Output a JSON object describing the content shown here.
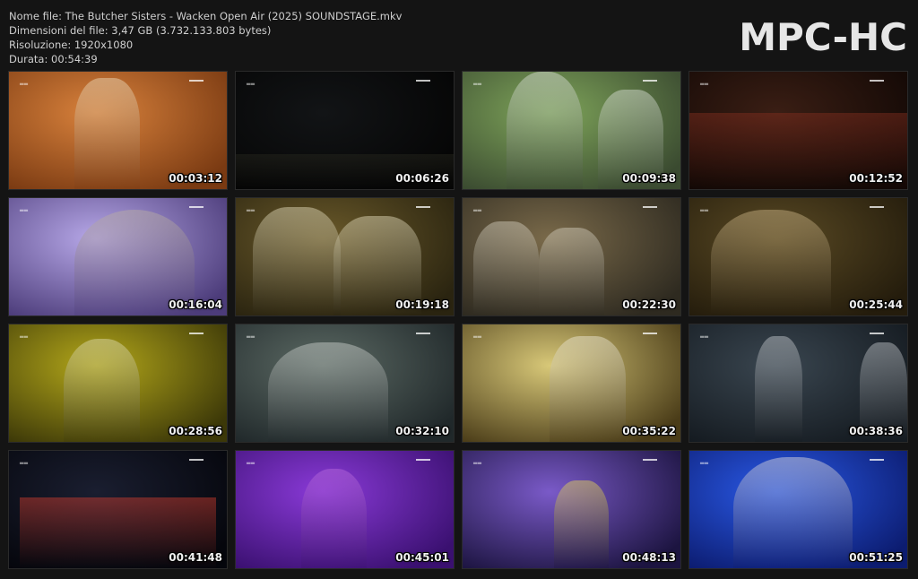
{
  "header": {
    "file_name": "Nome file: The Butcher Sisters - Wacken Open Air (2025) SOUNDSTAGE.mkv",
    "file_size": "Dimensioni del file: 3,47 GB (3.732.133.803 bytes)",
    "resolution": "Risoluzione: 1920x1080",
    "duration": "Durata: 00:54:39",
    "logo": "MPC-HC"
  },
  "thumbnails": [
    {
      "timestamp": "00:03:12",
      "bg": [
        "#d9823c",
        "#7a3a12"
      ],
      "accent": "#f2e6c8"
    },
    {
      "timestamp": "00:06:26",
      "bg": [
        "#121416",
        "#050505"
      ],
      "accent": "#2a2a20"
    },
    {
      "timestamp": "00:09:38",
      "bg": [
        "#7fa55a",
        "#3a4a30"
      ],
      "accent": "#e8ece6"
    },
    {
      "timestamp": "00:12:52",
      "bg": [
        "#3a1e14",
        "#120805"
      ],
      "accent": "#8a3020"
    },
    {
      "timestamp": "00:16:04",
      "bg": [
        "#b7a8e8",
        "#4c3c7a"
      ],
      "accent": "#bfb4a0"
    },
    {
      "timestamp": "00:19:18",
      "bg": [
        "#6b5a2a",
        "#2a2410"
      ],
      "accent": "#efe8c8"
    },
    {
      "timestamp": "00:22:30",
      "bg": [
        "#7a6a4a",
        "#2e2a20"
      ],
      "accent": "#ddd8c8"
    },
    {
      "timestamp": "00:25:44",
      "bg": [
        "#5a4a24",
        "#241c0c"
      ],
      "accent": "#d8c090"
    },
    {
      "timestamp": "00:28:56",
      "bg": [
        "#b4a81a",
        "#3c3808"
      ],
      "accent": "#e8e6c0"
    },
    {
      "timestamp": "00:32:10",
      "bg": [
        "#5c6a64",
        "#20282a"
      ],
      "accent": "#d8dcd8"
    },
    {
      "timestamp": "00:35:22",
      "bg": [
        "#d8c878",
        "#4a3c18"
      ],
      "accent": "#f4f0e0"
    },
    {
      "timestamp": "00:38:36",
      "bg": [
        "#3a4650",
        "#141a20"
      ],
      "accent": "#d0d4d8"
    },
    {
      "timestamp": "00:41:48",
      "bg": [
        "#1a1e30",
        "#05060c"
      ],
      "accent": "#e04030"
    },
    {
      "timestamp": "00:45:01",
      "bg": [
        "#8a3ad8",
        "#3a1070"
      ],
      "accent": "#c070e0"
    },
    {
      "timestamp": "00:48:13",
      "bg": [
        "#7a5ac8",
        "#1c1440"
      ],
      "accent": "#f0e050"
    },
    {
      "timestamp": "00:51:25",
      "bg": [
        "#2a5ae8",
        "#0c1c70"
      ],
      "accent": "#f0e8e0"
    }
  ]
}
